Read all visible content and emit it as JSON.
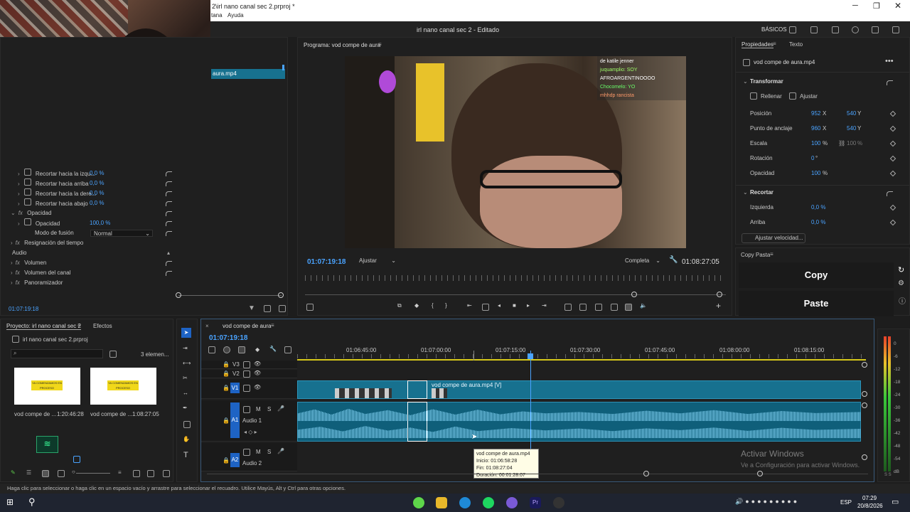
{
  "window": {
    "title": "2\\irl nano canal sec 2.prproj *",
    "menu": [
      "tana",
      "Ayuda"
    ],
    "center_title": "irl nano canal sec 2 - Editado",
    "workspace": "BÁSICOS"
  },
  "effect_controls": {
    "clip_label": "aura.mp4",
    "time": "01:07:19:18",
    "rows": [
      {
        "label": "Recortar hacia la izqu...",
        "value": "0,0 %"
      },
      {
        "label": "Recortar hacia arriba",
        "value": "0,0 %"
      },
      {
        "label": "Recortar hacia la dere...",
        "value": "0,0 %"
      },
      {
        "label": "Recortar hacia abajo",
        "value": "0,0 %"
      }
    ],
    "opacity_group": "Opacidad",
    "opacity_label": "Opacidad",
    "opacity_value": "100,0 %",
    "blend_label": "Modo de fusión",
    "blend_value": "Normal",
    "time_remap": "Resignación del tiempo",
    "audio_header": "Audio",
    "audio_rows": [
      "Volumen",
      "Volumen del canal",
      "Panoramizador"
    ]
  },
  "program": {
    "title": "Programa: vod compe de aura",
    "timecode": "01:07:19:18",
    "fit": "Ajustar",
    "quality": "Completa",
    "duration": "01:08:27:05",
    "chat": [
      "de katile jenner",
      "juquamplio: SOY",
      "AFROARGENTINOOOO",
      "Chocomelo: YO",
      "mhhdp rancista"
    ]
  },
  "properties": {
    "tabs": [
      "Propiedades",
      "Texto"
    ],
    "clip": "vod compe de aura.mp4",
    "transform": "Transformar",
    "fill": "Rellenar",
    "fit": "Ajustar",
    "rows": [
      {
        "label": "Posición",
        "v1": "952",
        "u1": "X",
        "v2": "540",
        "u2": "Y"
      },
      {
        "label": "Punto de anclaje",
        "v1": "960",
        "u1": "X",
        "v2": "540",
        "u2": "Y"
      },
      {
        "label": "Escala",
        "v1": "100",
        "u1": "%",
        "v2": "100",
        "u2": "%"
      },
      {
        "label": "Rotación",
        "v1": "0",
        "u1": "°",
        "v2": "",
        "u2": ""
      },
      {
        "label": "Opacidad",
        "v1": "100",
        "u1": "%",
        "v2": "",
        "u2": ""
      }
    ],
    "crop": "Recortar",
    "crop_rows": [
      {
        "label": "Izquierda",
        "value": "0,0 %"
      },
      {
        "label": "Arriba",
        "value": "0,0 %"
      }
    ],
    "speed_btn": "Ajustar velocidad..."
  },
  "copy_paste": {
    "title": "Copy Pasta",
    "copy": "Copy",
    "paste": "Paste"
  },
  "project": {
    "tabs": [
      "Proyecto: irl nano canal sec 2",
      "Efectos"
    ],
    "file": "irl nano canal sec 2.prproj",
    "count": "3 elemen...",
    "items": [
      {
        "name": "vod compe de ...",
        "dur": "1:20:46:28",
        "thumb": "YA COMENZAMOS EN PROCESO"
      },
      {
        "name": "vod compe de ...",
        "dur": "1:08:27:05",
        "thumb": "YA COMENZAMOS EN PROCESO"
      }
    ]
  },
  "timeline": {
    "seq": "vod compe de aura",
    "time": "01:07:19:18",
    "ruler": [
      "01:06:45:00",
      "01:07:00:00",
      "01:07:15:00",
      "01:07:30:00",
      "01:07:45:00",
      "01:08:00:00",
      "01:08:15:00"
    ],
    "tracks": {
      "v3": "V3",
      "v2": "V2",
      "v1": "V1",
      "a1": "A1",
      "a1_name": "Audio 1",
      "a2": "A2",
      "a2_name": "Audio 2"
    },
    "clip_label": "vod compe de aura.mp4 [V]",
    "tooltip": [
      "vod compe de aura.mp4",
      "Inicio: 01:06:58:28",
      "Fin: 01:08:27:04",
      "Duración: 00:01:28:07"
    ]
  },
  "meter": {
    "labels": [
      "0",
      "-6",
      "-12",
      "-18",
      "-24",
      "-30",
      "-36",
      "-42",
      "-48",
      "-54",
      "dB"
    ],
    "footer": "S S"
  },
  "watermark": {
    "l1": "Activar Windows",
    "l2": "Ve a Configuración para activar Windows."
  },
  "status": "Haga clic para seleccionar o haga clic en un espacio vacío y arrastre para seleccionar el recuadro. Utilice Mayús, Alt y Ctrl para otras opciones.",
  "taskbar": {
    "lang": "ESP",
    "time": "07:29",
    "date": "20/8/2026"
  }
}
